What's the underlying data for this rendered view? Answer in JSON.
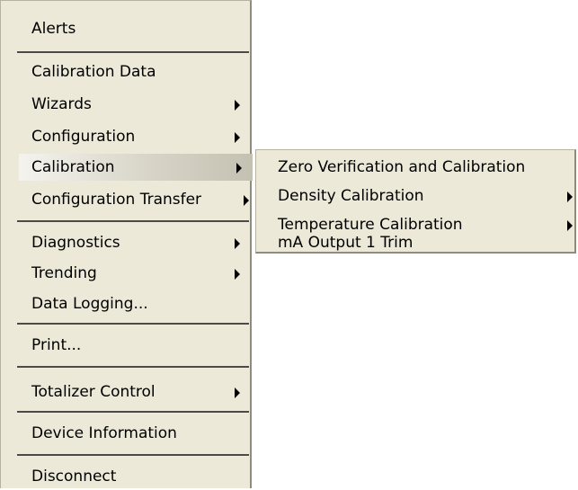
{
  "main_menu": {
    "items": [
      {
        "label": "Alerts",
        "has_submenu": false
      },
      {
        "label": "Calibration Data",
        "has_submenu": false
      },
      {
        "label": "Wizards",
        "has_submenu": true
      },
      {
        "label": "Configuration",
        "has_submenu": true
      },
      {
        "label": "Calibration",
        "has_submenu": true,
        "highlighted": true
      },
      {
        "label": "Configuration Transfer",
        "has_submenu": true
      },
      {
        "label": "Diagnostics",
        "has_submenu": true
      },
      {
        "label": "Trending",
        "has_submenu": true
      },
      {
        "label": "Data Logging...",
        "has_submenu": false
      },
      {
        "label": "Print...",
        "has_submenu": false
      },
      {
        "label": "Totalizer Control",
        "has_submenu": true
      },
      {
        "label": "Device Information",
        "has_submenu": false
      },
      {
        "label": "Disconnect",
        "has_submenu": false
      }
    ]
  },
  "calibration_submenu": {
    "items": [
      {
        "label": "Zero Verification and Calibration",
        "has_submenu": false
      },
      {
        "label": "Density Calibration",
        "has_submenu": true
      },
      {
        "label": "Temperature Calibration",
        "has_submenu": true
      },
      {
        "label": "mA Output 1 Trim",
        "has_submenu": false
      }
    ]
  },
  "colors": {
    "menu_bg": "#ece9d8",
    "separator": "#4a4a4a",
    "highlight_start": "#f4f3ee",
    "highlight_end": "#c4c1b2"
  }
}
